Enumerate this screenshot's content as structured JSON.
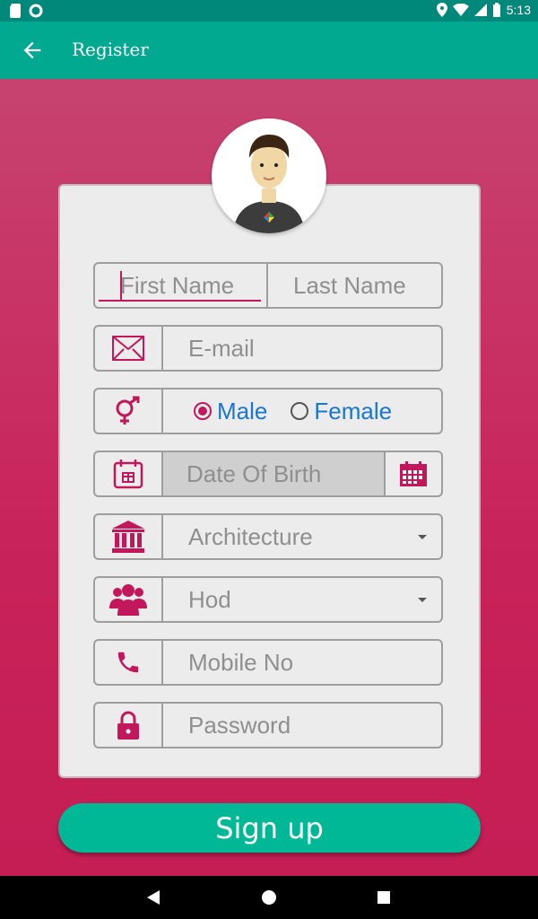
{
  "status_bar": {
    "time": "5:13"
  },
  "app_bar": {
    "title": "Register"
  },
  "form": {
    "first_name": {
      "placeholder": "First Name"
    },
    "last_name": {
      "placeholder": "Last Name"
    },
    "email": {
      "placeholder": "E-mail"
    },
    "gender": {
      "options": [
        "Male",
        "Female"
      ],
      "selected": "Male"
    },
    "dob": {
      "placeholder": "Date Of Birth"
    },
    "department": {
      "selected": "Architecture"
    },
    "role": {
      "selected": "Hod"
    },
    "mobile": {
      "placeholder": "Mobile No"
    },
    "password": {
      "placeholder": "Password"
    }
  },
  "signup_label": "Sign up",
  "colors": {
    "accent": "#00a98f",
    "brand": "#c2185b",
    "link": "#1976d2"
  }
}
